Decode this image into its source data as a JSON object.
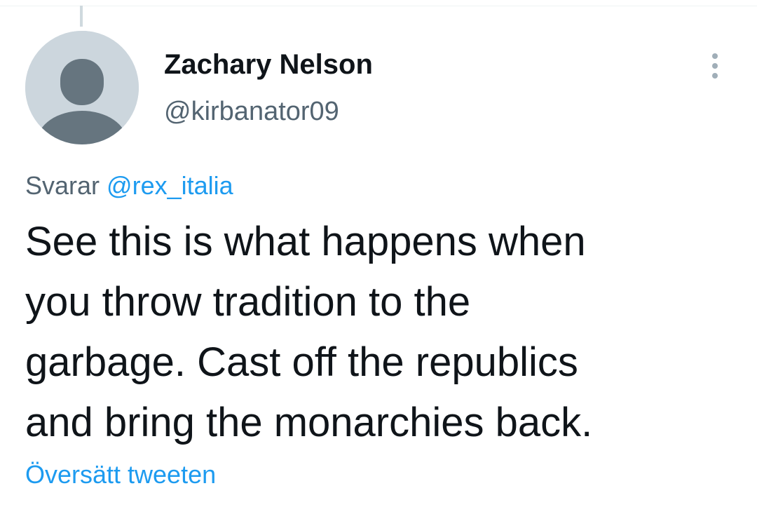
{
  "tweet": {
    "author": {
      "name": "Zachary Nelson",
      "handle": "@kirbanator09",
      "avatar_icon": "default-avatar-icon"
    },
    "more_icon": "more-options-icon",
    "reply": {
      "prefix": "Svarar",
      "mention": "@rex_italia"
    },
    "text_lines": [
      "See this is what happens when",
      "you throw tradition to the",
      "garbage. Cast off the republics",
      "and bring the monarchies back."
    ],
    "translate_label": "Översätt tweeten"
  },
  "colors": {
    "primary_text": "#0f1419",
    "secondary_text": "#536471",
    "link_blue": "#1d9bf0",
    "avatar_bg": "#ccd6dd",
    "avatar_figure": "#66757f"
  }
}
